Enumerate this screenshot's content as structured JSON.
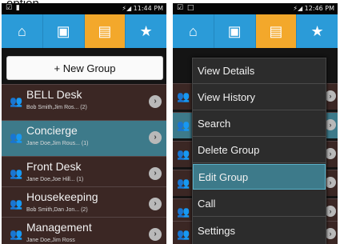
{
  "caption": "option",
  "left": {
    "status_time": "11:44 PM",
    "status_icons": "☑ ▮",
    "new_group_label": "+ New Group",
    "groups": [
      {
        "name": "BELL Desk",
        "members": "Bob Smith,Jim Ros... (2)"
      },
      {
        "name": "Concierge",
        "members": "Jane Doe,Jim Rous... (1)"
      },
      {
        "name": "Front Desk",
        "members": "Jane Doe,Joe Hill... (1)"
      },
      {
        "name": "Housekeeping",
        "members": "Bob Smith,Dan Jon... (2)"
      },
      {
        "name": "Management",
        "members": "Jane Doe,Jim Ross"
      }
    ]
  },
  "right": {
    "status_time": "12:46 PM",
    "status_icons": "☑ □",
    "menu": [
      "View Details",
      "View History",
      "Search",
      "Delete Group",
      "Edit Group",
      "Call",
      "Settings"
    ]
  },
  "colors": {
    "tab_bar": "#2b9bd8",
    "tab_active": "#f3a82b",
    "row_bg": "#3b2724",
    "row_selected": "#3d7a8a"
  },
  "icons": {
    "tabs": [
      "home-icon",
      "contact-card-icon",
      "group-card-icon",
      "favorites-star-icon"
    ],
    "row": "person-icon",
    "row_action": "chevron-right-icon"
  }
}
